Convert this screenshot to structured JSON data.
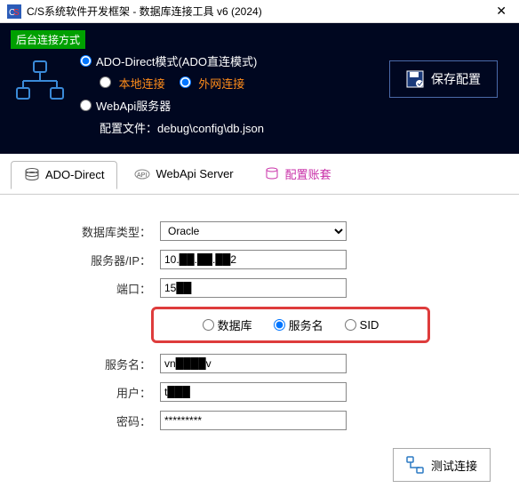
{
  "window": {
    "title": "C/S系统软件开发框架 - 数据库连接工具 v6 (2024)"
  },
  "backend": {
    "tag": "后台连接方式",
    "ado_label": "ADO-Direct模式(ADO直连模式)",
    "local_label": "本地连接",
    "external_label": "外网连接",
    "webapi_label": "WebApi服务器",
    "config_label": "配置文件：debug\\config\\db.json",
    "save_label": "保存配置"
  },
  "tabs": {
    "ado": "ADO-Direct",
    "webapi": "WebApi Server",
    "account": "配置账套"
  },
  "form": {
    "dbtype_label": "数据库类型：",
    "dbtype_value": "Oracle",
    "server_label": "服务器/IP：",
    "server_value": "10.██.██.██2",
    "port_label": "端口：",
    "port_value": "15██",
    "rb_db": "数据库",
    "rb_service": "服务名",
    "rb_sid": "SID",
    "service_label": "服务名：",
    "service_value": "vn████v",
    "user_label": "用户：",
    "user_value": "t███",
    "pwd_label": "密码：",
    "pwd_value": "*********"
  },
  "actions": {
    "test_label": "测试连接"
  }
}
